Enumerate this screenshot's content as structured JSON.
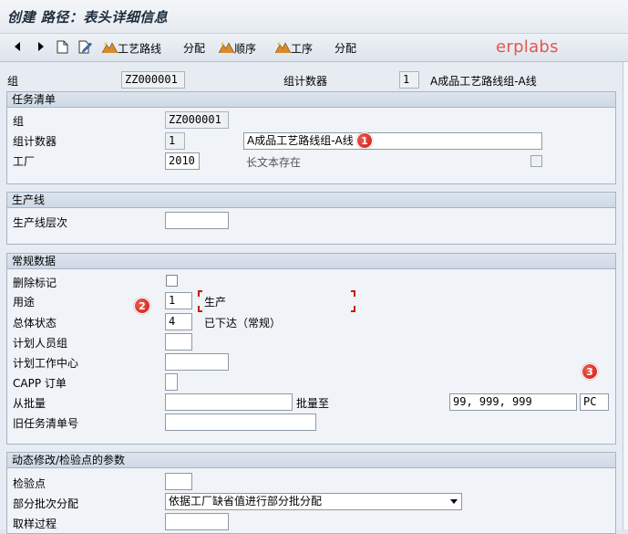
{
  "title": "创建 路径：表头详细信息",
  "toolbar": {
    "items": [
      {
        "label": "工艺路线"
      },
      {
        "label": "分配"
      },
      {
        "label": "顺序"
      },
      {
        "label": "工序"
      },
      {
        "label": "分配"
      }
    ],
    "brand": "erplabs"
  },
  "header_row": {
    "group_label": "组",
    "group_value": "ZZ000001",
    "counter_label": "组计数器",
    "counter_value": "1",
    "desc": "A成品工艺路线组-A线"
  },
  "task_list": {
    "title": "任务清单",
    "group_label": "组",
    "group_value": "ZZ000001",
    "counter_label": "组计数器",
    "counter_value": "1",
    "desc_value": "A成品工艺路线组-A线",
    "plant_label": "工厂",
    "plant_value": "2010",
    "longtext_label": "长文本存在"
  },
  "production_line": {
    "title": "生产线",
    "level_label": "生产线层次",
    "level_value": ""
  },
  "general": {
    "title": "常规数据",
    "deletion_label": "删除标记",
    "usage_label": "用途",
    "usage_value": "1",
    "usage_text": "生产",
    "status_label": "总体状态",
    "status_value": "4",
    "status_text": "已下达（常规）",
    "planner_group_label": "计划人员组",
    "work_center_label": "计划工作中心",
    "capp_label": "CAPP 订单",
    "from_lot_label": "从批量",
    "to_lot_label": "批量至",
    "to_lot_value": "99, 999, 999",
    "unit_value": "PC",
    "old_task_label": "旧任务清单号"
  },
  "dynamic": {
    "title": "动态修改/检验点的参数",
    "inspection_label": "检验点",
    "partial_lot_label": "部分批次分配",
    "partial_lot_value": "依据工厂缺省值进行部分批分配",
    "sampling_label": "取样过程"
  },
  "badges": [
    "1",
    "2",
    "3"
  ],
  "colors": {
    "brand": "#e2584a",
    "badge": "#d8291f",
    "section_header": "#d4dde8"
  }
}
